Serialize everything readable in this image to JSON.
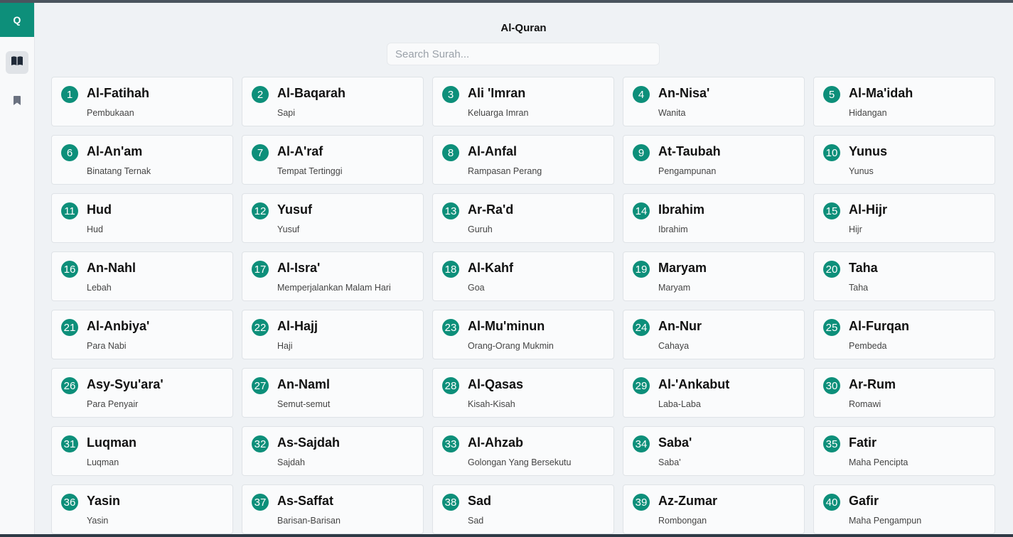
{
  "app": {
    "logo_letter": "Q",
    "title": "Al-Quran"
  },
  "sidebar": {
    "items": [
      {
        "icon": "book-open-icon",
        "active": true
      },
      {
        "icon": "bookmark-icon",
        "active": false
      }
    ]
  },
  "search": {
    "placeholder": "Search Surah...",
    "value": ""
  },
  "colors": {
    "accent": "#0d8f7a",
    "background": "#eff2f5",
    "card": "#fafbfc"
  },
  "surahs": [
    {
      "number": "1",
      "name": "Al-Fatihah",
      "meaning": "Pembukaan"
    },
    {
      "number": "2",
      "name": "Al-Baqarah",
      "meaning": "Sapi"
    },
    {
      "number": "3",
      "name": "Ali 'Imran",
      "meaning": "Keluarga Imran"
    },
    {
      "number": "4",
      "name": "An-Nisa'",
      "meaning": "Wanita"
    },
    {
      "number": "5",
      "name": "Al-Ma'idah",
      "meaning": "Hidangan"
    },
    {
      "number": "6",
      "name": "Al-An'am",
      "meaning": "Binatang Ternak"
    },
    {
      "number": "7",
      "name": "Al-A'raf",
      "meaning": "Tempat Tertinggi"
    },
    {
      "number": "8",
      "name": "Al-Anfal",
      "meaning": "Rampasan Perang"
    },
    {
      "number": "9",
      "name": "At-Taubah",
      "meaning": "Pengampunan"
    },
    {
      "number": "10",
      "name": "Yunus",
      "meaning": "Yunus"
    },
    {
      "number": "11",
      "name": "Hud",
      "meaning": "Hud"
    },
    {
      "number": "12",
      "name": "Yusuf",
      "meaning": "Yusuf"
    },
    {
      "number": "13",
      "name": "Ar-Ra'd",
      "meaning": "Guruh"
    },
    {
      "number": "14",
      "name": "Ibrahim",
      "meaning": "Ibrahim"
    },
    {
      "number": "15",
      "name": "Al-Hijr",
      "meaning": "Hijr"
    },
    {
      "number": "16",
      "name": "An-Nahl",
      "meaning": "Lebah"
    },
    {
      "number": "17",
      "name": "Al-Isra'",
      "meaning": "Memperjalankan Malam Hari"
    },
    {
      "number": "18",
      "name": "Al-Kahf",
      "meaning": "Goa"
    },
    {
      "number": "19",
      "name": "Maryam",
      "meaning": "Maryam"
    },
    {
      "number": "20",
      "name": "Taha",
      "meaning": "Taha"
    },
    {
      "number": "21",
      "name": "Al-Anbiya'",
      "meaning": "Para Nabi"
    },
    {
      "number": "22",
      "name": "Al-Hajj",
      "meaning": "Haji"
    },
    {
      "number": "23",
      "name": "Al-Mu'minun",
      "meaning": "Orang-Orang Mukmin"
    },
    {
      "number": "24",
      "name": "An-Nur",
      "meaning": "Cahaya"
    },
    {
      "number": "25",
      "name": "Al-Furqan",
      "meaning": "Pembeda"
    },
    {
      "number": "26",
      "name": "Asy-Syu'ara'",
      "meaning": "Para Penyair"
    },
    {
      "number": "27",
      "name": "An-Naml",
      "meaning": "Semut-semut"
    },
    {
      "number": "28",
      "name": "Al-Qasas",
      "meaning": "Kisah-Kisah"
    },
    {
      "number": "29",
      "name": "Al-'Ankabut",
      "meaning": "Laba-Laba"
    },
    {
      "number": "30",
      "name": "Ar-Rum",
      "meaning": "Romawi"
    },
    {
      "number": "31",
      "name": "Luqman",
      "meaning": "Luqman"
    },
    {
      "number": "32",
      "name": "As-Sajdah",
      "meaning": "Sajdah"
    },
    {
      "number": "33",
      "name": "Al-Ahzab",
      "meaning": "Golongan Yang Bersekutu"
    },
    {
      "number": "34",
      "name": "Saba'",
      "meaning": "Saba'"
    },
    {
      "number": "35",
      "name": "Fatir",
      "meaning": "Maha Pencipta"
    },
    {
      "number": "36",
      "name": "Yasin",
      "meaning": "Yasin"
    },
    {
      "number": "37",
      "name": "As-Saffat",
      "meaning": "Barisan-Barisan"
    },
    {
      "number": "38",
      "name": "Sad",
      "meaning": "Sad"
    },
    {
      "number": "39",
      "name": "Az-Zumar",
      "meaning": "Rombongan"
    },
    {
      "number": "40",
      "name": "Gafir",
      "meaning": "Maha Pengampun"
    }
  ]
}
